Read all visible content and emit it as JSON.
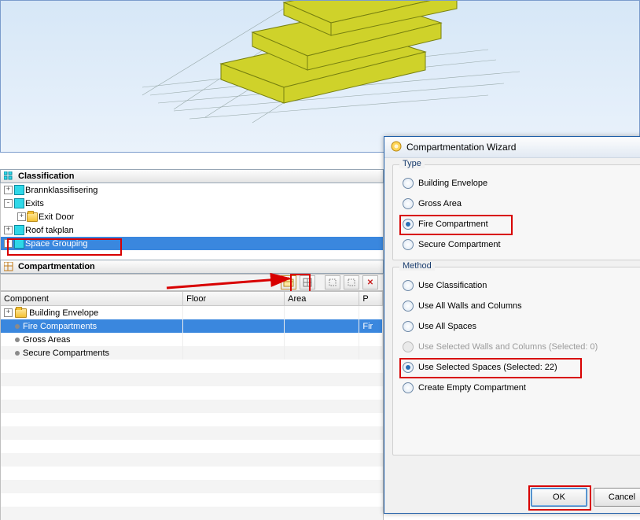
{
  "panels": {
    "classification_title": "Classification",
    "compartmentation_title": "Compartmentation"
  },
  "classification_tree": {
    "items": [
      {
        "label": "Brannklassifisering",
        "icon": "cyan",
        "expand": "+",
        "indent": 0
      },
      {
        "label": "Exits",
        "icon": "cyan",
        "expand": "-",
        "indent": 0
      },
      {
        "label": "Exit Door",
        "icon": "folder",
        "expand": "+",
        "indent": 1
      },
      {
        "label": "Roof takplan",
        "icon": "cyan",
        "expand": "+",
        "indent": 0
      },
      {
        "label": "Space Grouping",
        "icon": "cyan",
        "expand": "+",
        "indent": 0,
        "selected": true
      }
    ]
  },
  "grid": {
    "headers": {
      "component": "Component",
      "floor": "Floor",
      "area": "Area",
      "p": "P"
    },
    "rows": [
      {
        "component": "Building Envelope",
        "floor": "",
        "area": "",
        "p": "",
        "icon": "folder",
        "expand": "+",
        "indent": 0
      },
      {
        "component": "Fire Compartments",
        "floor": "",
        "area": "",
        "p": "Fir",
        "icon": "bullet",
        "expand": "",
        "indent": 1,
        "selected": true
      },
      {
        "component": "Gross Areas",
        "floor": "",
        "area": "",
        "p": "",
        "icon": "bullet",
        "expand": "",
        "indent": 1
      },
      {
        "component": "Secure Compartments",
        "floor": "",
        "area": "",
        "p": "",
        "icon": "bullet",
        "expand": "",
        "indent": 1
      }
    ]
  },
  "dialog": {
    "title": "Compartmentation Wizard",
    "type_group": "Type",
    "method_group": "Method",
    "type_options": [
      {
        "label": "Building Envelope",
        "checked": false
      },
      {
        "label": "Gross Area",
        "checked": false
      },
      {
        "label": "Fire Compartment",
        "checked": true,
        "highlight": true
      },
      {
        "label": "Secure Compartment",
        "checked": false
      }
    ],
    "method_options": [
      {
        "label": "Use Classification",
        "checked": false
      },
      {
        "label": "Use All Walls and Columns",
        "checked": false
      },
      {
        "label": "Use All Spaces",
        "checked": false
      },
      {
        "label": "Use Selected Walls and Columns (Selected: 0)",
        "checked": false,
        "disabled": true
      },
      {
        "label": "Use Selected Spaces (Selected: 22)",
        "checked": true,
        "highlight": true
      },
      {
        "label": "Create Empty Compartment",
        "checked": false
      }
    ],
    "ok": "OK",
    "cancel": "Cancel"
  }
}
